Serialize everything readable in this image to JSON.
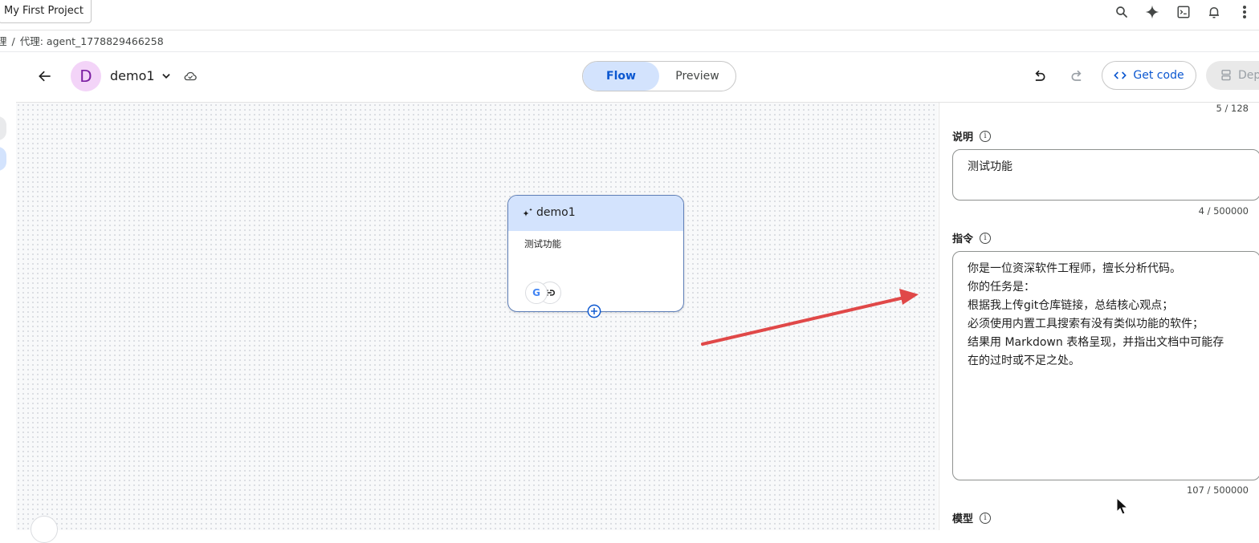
{
  "topbar": {
    "project": "My First Project",
    "icons": [
      "search-icon",
      "spark-icon",
      "terminal-icon",
      "bell-icon",
      "more-vert-icon"
    ]
  },
  "breadcrumb": {
    "items": [
      "理",
      "代理: agent_1778829466258"
    ]
  },
  "header": {
    "avatar_letter": "D",
    "agent_name": "demo1",
    "tabs": [
      {
        "label": "Flow",
        "active": true
      },
      {
        "label": "Preview",
        "active": false
      }
    ],
    "get_code": "Get code",
    "deploy": "Depl"
  },
  "canvas": {
    "node": {
      "title": "demo1",
      "description": "测试功能",
      "tools": [
        "google-icon",
        "link-icon"
      ]
    }
  },
  "panel": {
    "name_counter": "5 / 128",
    "description": {
      "label": "说明",
      "value": "测试功能",
      "counter": "4 / 500000"
    },
    "instructions": {
      "label": "指令",
      "value": "你是一位资深软件工程师，擅长分析代码。\n你的任务是：\n根据我上传git仓库链接，总结核心观点；\n必须使用内置工具搜索有没有类似功能的软件；\n结果用 Markdown 表格呈现，并指出文档中可能存\n在的过时或不足之处。",
      "counter": "107 / 500000"
    },
    "model": {
      "label": "模型"
    }
  },
  "colors": {
    "accent": "#0b57d0",
    "tab_active_bg": "#d3e3fd",
    "annotation_arrow": "#e04848",
    "avatar_bg": "#f3d4f8"
  }
}
